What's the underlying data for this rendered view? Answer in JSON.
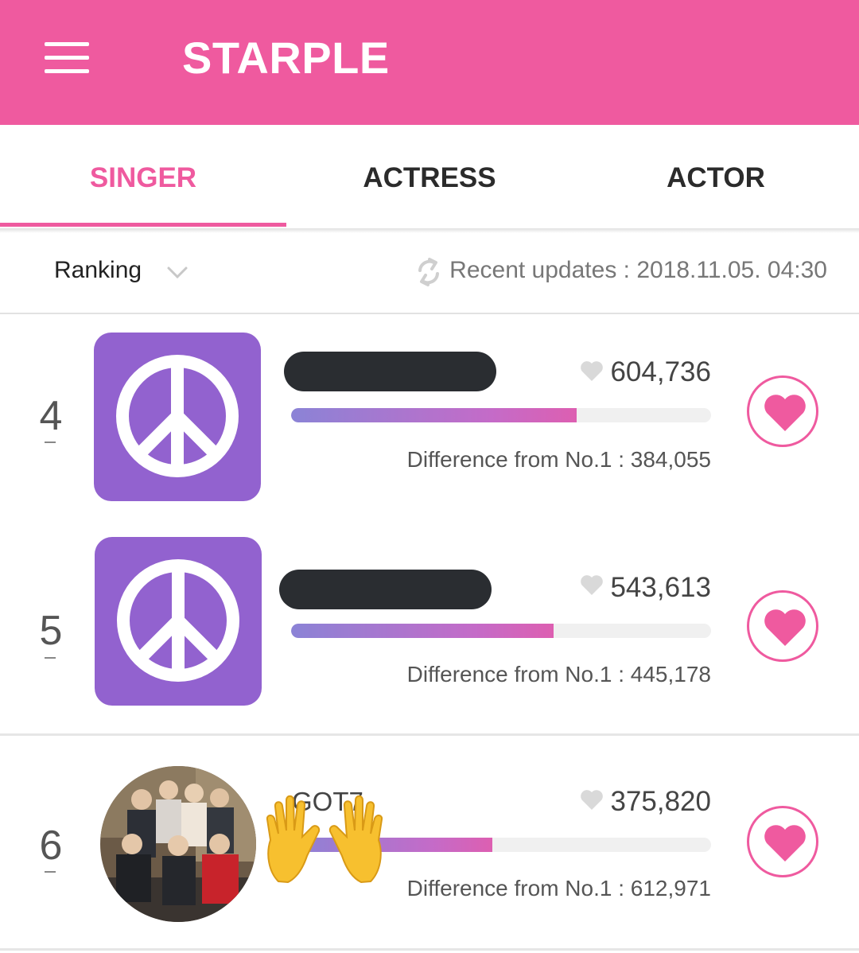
{
  "app": {
    "title": "STARPLE"
  },
  "tabs": [
    {
      "label": "SINGER",
      "active": true
    },
    {
      "label": "ACTRESS",
      "active": false
    },
    {
      "label": "ACTOR",
      "active": false
    }
  ],
  "filter": {
    "sort_label": "Ranking",
    "updates_text": "Recent updates : 2018.11.05. 04:30"
  },
  "colors": {
    "accent": "#ef5a9f",
    "thumb_purple": "#9262cf"
  },
  "rows": [
    {
      "rank": "4",
      "name": "",
      "name_redacted": true,
      "votes": "604,736",
      "progress": 0.68,
      "diff": "Difference from No.1 : 384,055",
      "thumbnail": "peace-sign-icon"
    },
    {
      "rank": "5",
      "name": "",
      "name_redacted": true,
      "votes": "543,613",
      "progress": 0.625,
      "diff": "Difference from No.1 : 445,178",
      "thumbnail": "peace-sign-icon"
    },
    {
      "rank": "6",
      "name": "GOT7",
      "name_redacted": false,
      "votes": "375,820",
      "progress": 0.48,
      "diff": "Difference from No.1 : 612,971",
      "thumbnail": "group-photo"
    }
  ],
  "overlay_emoji": "open-hands-emoji"
}
